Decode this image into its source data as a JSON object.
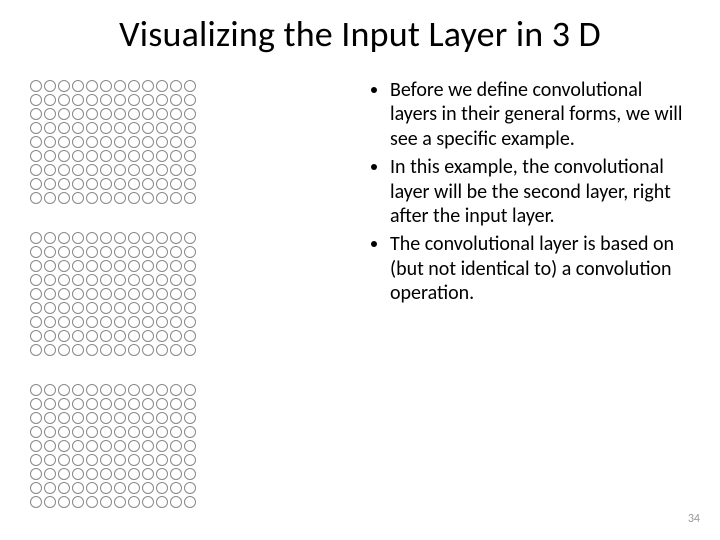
{
  "title": "Visualizing the Input Layer in 3 D",
  "bullets": [
    "Before we define convolutional layers in their general forms, we will see a specific example.",
    "In this example, the convolutional layer will be the second layer, right after the input layer.",
    "The convolutional layer is based on (but not identical to) a convolution operation."
  ],
  "grid": {
    "rows": 9,
    "cols": 12,
    "count": 3
  },
  "page_number": "34"
}
